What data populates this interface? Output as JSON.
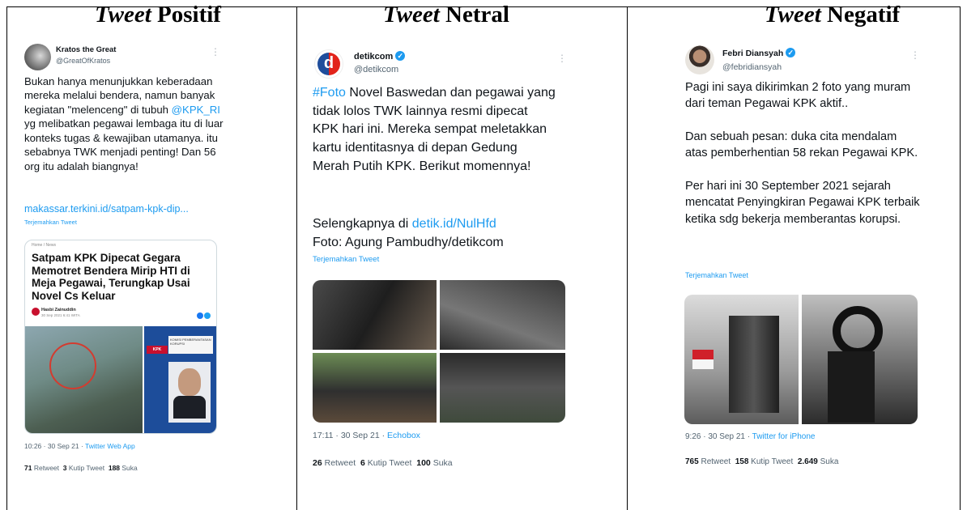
{
  "columns": [
    {
      "title_em": "Tweet",
      "title_rest": " Positif"
    },
    {
      "title_em": "Tweet",
      "title_rest": " Netral"
    },
    {
      "title_em": "Tweet",
      "title_rest": " Negatif"
    }
  ],
  "positive": {
    "name": "Kratos the Great",
    "handle": "@GreatOfKratos",
    "text_1": "Bukan hanya menunjukkan keberadaan mereka melalui bendera, namun banyak kegiatan \"melenceng\" di tubuh ",
    "mention": "@KPK_RI",
    "text_2": " yg melibatkan pegawai lembaga itu di luar konteks tugas & kewajiban utamanya. itu sebabnya TWK menjadi penting! Dan 56 org itu adalah biangnya!",
    "link": "makassar.terkini.id/satpam-kpk-dip...",
    "translate": "Terjemahkan Tweet",
    "card": {
      "crumb": "Home / News",
      "headline": "Satpam KPK Dipecat Gegara Memotret Bendera Mirip HTI di Meja Pegawai, Terungkap Usai Novel Cs Keluar",
      "author": "Hasbi Zainuddin",
      "date": "30 Sep 2021 6:41 WITA",
      "photo_caption": "KOMISI PEMBERANTASAN KORUPSI",
      "photo_badge": "KPK"
    },
    "time": "10:26 · 30 Sep 21 · ",
    "source": "Twitter Web App",
    "stats": {
      "retweet_n": "71",
      "retweet_l": " Retweet",
      "quote_n": "3",
      "quote_l": " Kutip Tweet",
      "like_n": "188",
      "like_l": " Suka"
    }
  },
  "neutral": {
    "name": "detikcom",
    "handle": "@detikcom",
    "hashtag": "#Foto",
    "text_1": " Novel Baswedan dan pegawai yang tidak lolos TWK lainnya resmi dipecat KPK hari ini. Mereka sempat meletakkan kartu identitasnya di depan Gedung Merah Putih KPK. Berikut momennya!",
    "more_prefix": "Selengkapnya di ",
    "more_link": "detik.id/NulHfd",
    "credit": "Foto: Agung Pambudhy/detikcom",
    "translate": "Terjemahkan Tweet",
    "time": "17:11 · 30 Sep 21 · ",
    "source": "Echobox",
    "stats": {
      "retweet_n": "26",
      "retweet_l": " Retweet",
      "quote_n": "6",
      "quote_l": " Kutip Tweet",
      "like_n": "100",
      "like_l": " Suka"
    }
  },
  "negative": {
    "name": "Febri Diansyah",
    "handle": "@febridiansyah",
    "para_1": "Pagi ini saya dikirimkan 2 foto yang muram dari teman Pegawai KPK aktif..",
    "para_2": "Dan sebuah pesan: duka cita mendalam atas pemberhentian 58 rekan Pegawai KPK.",
    "para_3": "Per hari ini 30 September 2021 sejarah mencatat Penyingkiran Pegawai KPK terbaik ketika sdg bekerja memberantas korupsi.",
    "translate": "Terjemahkan Tweet",
    "time": "9:26 · 30 Sep 21 · ",
    "source": "Twitter for iPhone",
    "stats": {
      "retweet_n": "765",
      "retweet_l": " Retweet",
      "quote_n": "158",
      "quote_l": " Kutip Tweet",
      "like_n": "2.649",
      "like_l": " Suka"
    }
  },
  "colors": {
    "link": "#1d9bf0",
    "muted": "#536471",
    "verified": "#1d9bf0",
    "border": "#000000"
  },
  "icons": [
    "more-options-icon",
    "verified-badge-icon"
  ]
}
